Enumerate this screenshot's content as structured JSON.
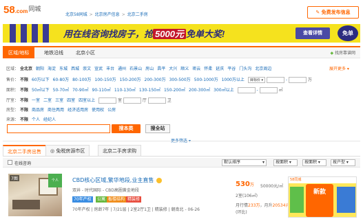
{
  "header": {
    "logo": "58",
    "logo_suffix": ".com",
    "logo_cn": "同城",
    "breadcrumb": [
      "北京58同城",
      "北京房产信息",
      "北京二手房"
    ],
    "post_button": "免费发布信息"
  },
  "banner": {
    "text_pre": "用在线咨询找房子，抢",
    "text_highlight": "5000元",
    "text_post": "免单大奖!",
    "detail_button": "查看详情",
    "badge": "免单"
  },
  "tabs": [
    "区域/地标",
    "地铁沿线",
    "北京小区"
  ],
  "agent_link": "找房靠谱网",
  "filters": {
    "area": {
      "label": "区域：",
      "current": "全北京",
      "items": [
        "朝阳",
        "海淀",
        "东城",
        "西城",
        "崇文",
        "宣武",
        "丰台",
        "通州",
        "石景山",
        "房山",
        "昌平",
        "大兴",
        "顺义",
        "密云",
        "怀柔",
        "延庆",
        "平谷",
        "门头沟",
        "北京周边"
      ]
    },
    "more": "展开更多",
    "price": {
      "label": "售价：",
      "current": "不限",
      "items": [
        "60万以下",
        "60-80万",
        "80-100万",
        "100-150万",
        "150-200万",
        "200-300万",
        "300-500万",
        "500-1000万",
        "1000万以上"
      ],
      "select": "目标价",
      "unit": "万"
    },
    "size": {
      "label": "面积：",
      "current": "不限",
      "items": [
        "50㎡以下",
        "50-70㎡",
        "70-90㎡",
        "90-110㎡",
        "110-130㎡",
        "130-150㎡",
        "150-200㎡",
        "200-300㎡",
        "300㎡以上"
      ],
      "unit": "㎡"
    },
    "room": {
      "label": "厅室：",
      "current": "不限",
      "items": [
        "一室",
        "二室",
        "三室",
        "四室",
        "四室以上"
      ],
      "unit1": "室",
      "unit2": "厅",
      "unit3": "卫"
    },
    "type": {
      "label": "房型：",
      "current": "不限",
      "items": [
        "商品房",
        "商住两用",
        "经济适用房",
        "使用权",
        "公房"
      ]
    },
    "source": {
      "label": "来源：",
      "current": "不限",
      "items": [
        "个人",
        "经纪人"
      ]
    }
  },
  "search": {
    "placeholder": "",
    "find_button": "搜本类",
    "find_all_button": "搜全站"
  },
  "more_filter": "更多筛选 ▾",
  "result_tabs": [
    "北京二手房出售",
    "免税房源市区",
    "北京二手房求购"
  ],
  "sortbar": {
    "online": "在线咨询",
    "sort": "默认排序",
    "price": "按面积",
    "size": "按面积",
    "room": "按户型"
  },
  "listing": {
    "photo_count": "7图",
    "verified": "个人",
    "title": "CBD核心区域,繁华地段,业主直售",
    "subtitle": "双井 - 时代国际 - CBD高圈黄金地段",
    "tags": [
      {
        "text": "70年产权",
        "color": "#3a8de2"
      },
      {
        "text": "公寓",
        "color": "#67b83f"
      },
      {
        "text": "板楼结构",
        "color": "#f08c19"
      },
      {
        "text": "精装修",
        "color": "#e84c3d"
      }
    ],
    "desc": "70年产权 | 房龄7年 | 7/21层 | 2室2厅1卫 | 精装修 | 朝南北 - 06-26",
    "price": "530",
    "price_unit": "万",
    "unit_price": "50000元/㎡",
    "area": "2室(106㎡)",
    "stats_pre": "月行情",
    "stats_views": "233万",
    "stats_post": "，月升",
    "stats_rate": "20534元",
    "stats2": "(环比)"
  },
  "ad": {
    "header": "58同城",
    "main": "新款"
  }
}
